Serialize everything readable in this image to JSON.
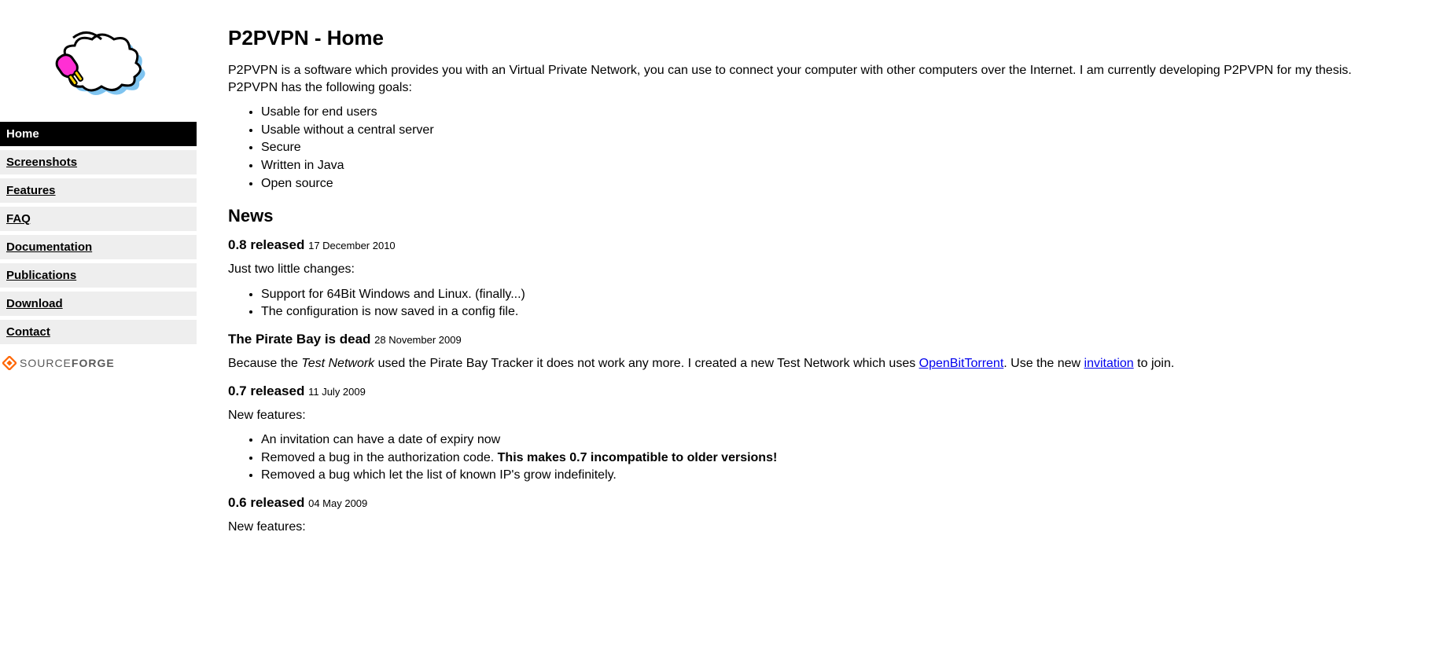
{
  "sidebar": {
    "nav": [
      {
        "label": "Home",
        "active": true
      },
      {
        "label": "Screenshots",
        "active": false
      },
      {
        "label": "Features",
        "active": false
      },
      {
        "label": "FAQ",
        "active": false
      },
      {
        "label": "Documentation",
        "active": false
      },
      {
        "label": "Publications",
        "active": false
      },
      {
        "label": "Download",
        "active": false
      },
      {
        "label": "Contact",
        "active": false
      }
    ],
    "badge_brand_1": "SOURCE",
    "badge_brand_2": "FORGE"
  },
  "page": {
    "title": "P2PVPN - Home",
    "intro": "P2PVPN is a software which provides you with an Virtual Private Network, you can use to connect your computer with other computers over the Internet. I am currently developing P2PVPN for my thesis. P2PVPN has the following goals:",
    "goals": [
      "Usable for end users",
      "Usable without a central server",
      "Secure",
      "Written in Java",
      "Open source"
    ],
    "news_heading": "News",
    "items": [
      {
        "title": "0.8 released",
        "date": "17 December 2010",
        "lead": "Just two little changes:",
        "bullets_plain": [
          "Support for 64Bit Windows and Linux. (finally...)",
          "The configuration is now saved in a config file."
        ]
      },
      {
        "title": "The Pirate Bay is dead",
        "date": "28 November 2009",
        "para": {
          "p1": "Because the ",
          "em": "Test Network",
          "p2": " used the Pirate Bay Tracker it does not work any more. I created a new Test Network which uses ",
          "link1": "OpenBitTorrent",
          "p3": ". Use the new ",
          "link2": "invitation",
          "p4": " to join."
        }
      },
      {
        "title": "0.7 released",
        "date": "11 July 2009",
        "lead": "New features:",
        "bullets": {
          "b0": "An invitation can have a date of expiry now",
          "b1a": "Removed a bug in the authorization code. ",
          "b1b": "This makes 0.7 incompatible to older versions!",
          "b2": "Removed a bug which let the list of known IP's grow indefinitely."
        }
      },
      {
        "title": "0.6 released",
        "date": "04 May 2009",
        "lead": "New features:"
      }
    ]
  }
}
